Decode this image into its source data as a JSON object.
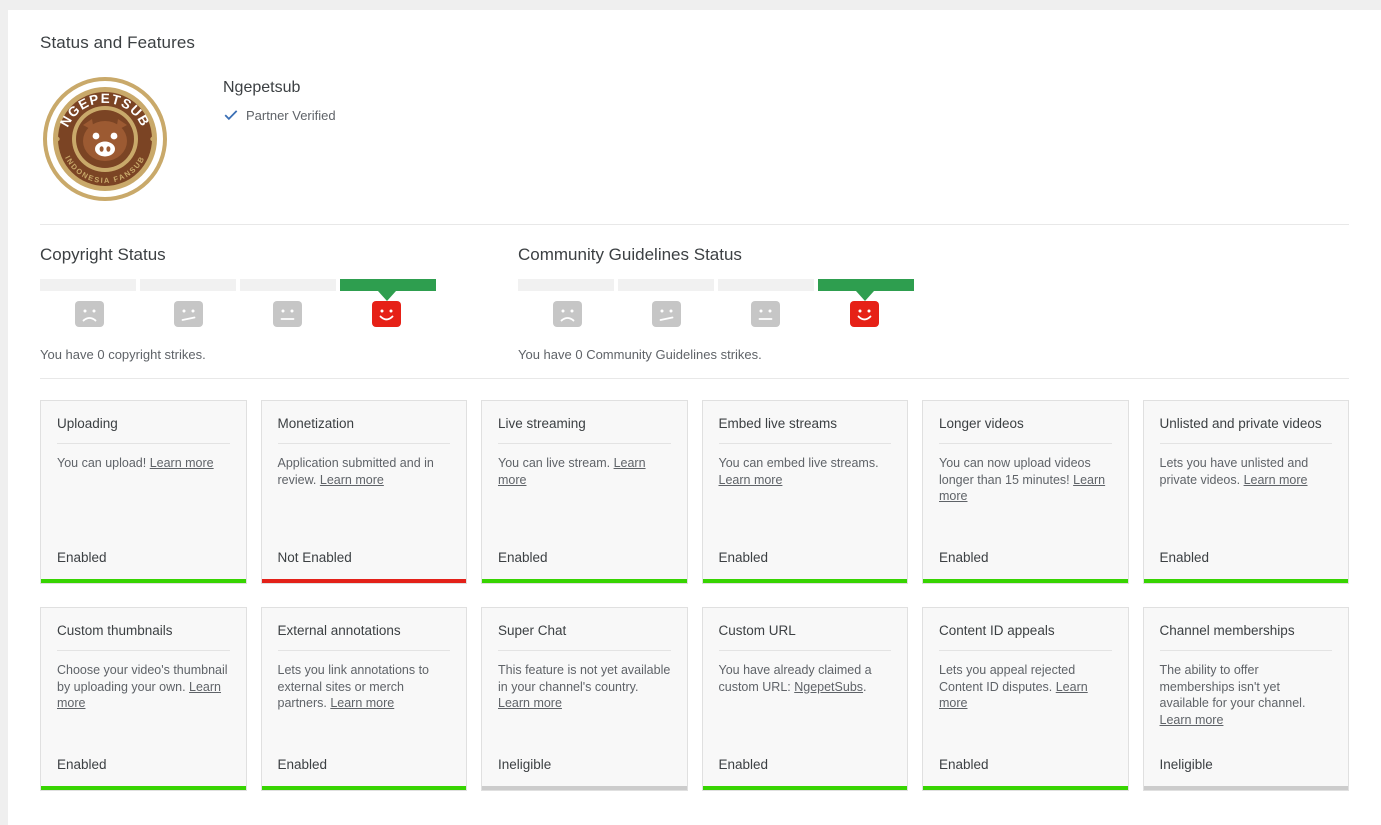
{
  "page": {
    "title": "Status and Features"
  },
  "channel": {
    "name": "Ngepetsub",
    "verified_label": "Partner Verified",
    "verified_icon": "check-icon",
    "logo": {
      "icon": "channel-logo-icon",
      "top_arc_text": "NGEPETSUB",
      "bottom_arc_text": "INDONESIA FANSUB",
      "ring_color": "#c9a96a",
      "body_color": "#7b4424",
      "face_color": "#9c5a32"
    }
  },
  "status_sections": [
    {
      "heading": "Copyright Status",
      "note": "You have 0 copyright strikes.",
      "segments": 4,
      "active_index": 3,
      "active_color": "#2e9e4f",
      "inactive_color": "#f1f1f1",
      "faces": [
        "sad-face-icon",
        "slight-frown-face-icon",
        "neutral-face-icon",
        "happy-face-icon"
      ],
      "active_face_color": "#e62117"
    },
    {
      "heading": "Community Guidelines Status",
      "note": "You have 0 Community Guidelines strikes.",
      "segments": 4,
      "active_index": 3,
      "active_color": "#2e9e4f",
      "inactive_color": "#f1f1f1",
      "faces": [
        "sad-face-icon",
        "slight-frown-face-icon",
        "neutral-face-icon",
        "happy-face-icon"
      ],
      "active_face_color": "#e62117"
    }
  ],
  "colors": {
    "enabled_bar": "#37d401",
    "not_enabled_bar": "#e32119",
    "ineligible_bar": "#cccccc",
    "verified_check": "#3a6fb5"
  },
  "feature_cards": [
    [
      {
        "title": "Uploading",
        "desc_text": "You can upload! ",
        "link_text": "Learn more",
        "desc_tail": "",
        "state": "Enabled",
        "bar_color": "#37d401"
      },
      {
        "title": "Monetization",
        "desc_text": "Application submitted and in review. ",
        "link_text": "Learn more",
        "desc_tail": "",
        "state": "Not Enabled",
        "bar_color": "#e32119"
      },
      {
        "title": "Live streaming",
        "desc_text": "You can live stream. ",
        "link_text": "Learn more",
        "desc_tail": "",
        "state": "Enabled",
        "bar_color": "#37d401"
      },
      {
        "title": "Embed live streams",
        "desc_text": "You can embed live streams. ",
        "link_text": "Learn more",
        "desc_tail": "",
        "state": "Enabled",
        "bar_color": "#37d401"
      },
      {
        "title": "Longer videos",
        "desc_text": "You can now upload videos longer than 15 minutes! ",
        "link_text": "Learn more",
        "desc_tail": "",
        "state": "Enabled",
        "bar_color": "#37d401"
      },
      {
        "title": "Unlisted and private videos",
        "desc_text": "Lets you have unlisted and private videos. ",
        "link_text": "Learn more",
        "desc_tail": "",
        "state": "Enabled",
        "bar_color": "#37d401"
      }
    ],
    [
      {
        "title": "Custom thumbnails",
        "desc_text": "Choose your video's thumbnail by uploading your own. ",
        "link_text": "Learn more",
        "desc_tail": "",
        "state": "Enabled",
        "bar_color": "#37d401"
      },
      {
        "title": "External annotations",
        "desc_text": "Lets you link annotations to external sites or merch partners. ",
        "link_text": "Learn more",
        "desc_tail": "",
        "state": "Enabled",
        "bar_color": "#37d401"
      },
      {
        "title": "Super Chat",
        "desc_text": "This feature is not yet available in your channel's country. ",
        "link_text": "Learn more",
        "desc_tail": "",
        "state": "Ineligible",
        "bar_color": "#cccccc"
      },
      {
        "title": "Custom URL",
        "desc_text": "You have already claimed a custom URL: ",
        "link_text": "NgepetSubs",
        "desc_tail": ".",
        "state": "Enabled",
        "bar_color": "#37d401"
      },
      {
        "title": "Content ID appeals",
        "desc_text": "Lets you appeal rejected Content ID disputes. ",
        "link_text": "Learn more",
        "desc_tail": "",
        "state": "Enabled",
        "bar_color": "#37d401"
      },
      {
        "title": "Channel memberships",
        "desc_text": "The ability to offer memberships isn't yet available for your channel. ",
        "link_text": "Learn more",
        "desc_tail": "",
        "state": "Ineligible",
        "bar_color": "#cccccc"
      }
    ]
  ]
}
